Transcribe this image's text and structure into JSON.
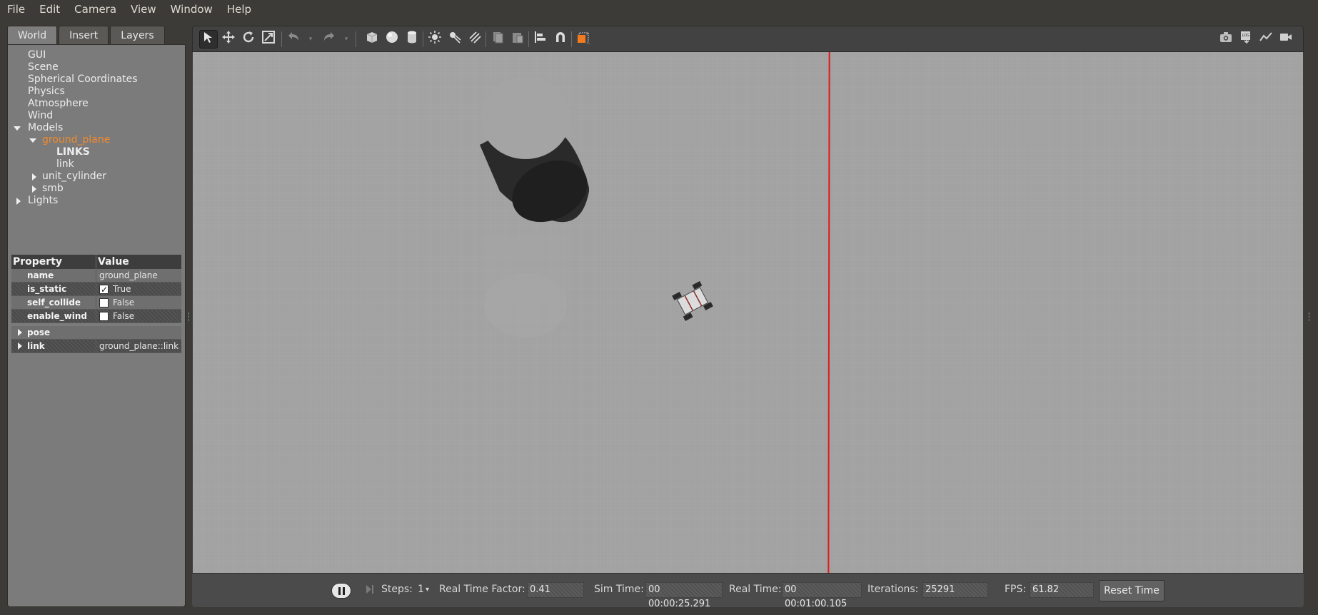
{
  "menu": [
    "File",
    "Edit",
    "Camera",
    "View",
    "Window",
    "Help"
  ],
  "left_tabs": [
    "World",
    "Insert",
    "Layers"
  ],
  "tree": {
    "gui": "GUI",
    "scene": "Scene",
    "spherical": "Spherical Coordinates",
    "physics": "Physics",
    "atmosphere": "Atmosphere",
    "wind": "Wind",
    "models": "Models",
    "ground_plane": "ground_plane",
    "links": "LINKS",
    "link": "link",
    "unit_cylinder": "unit_cylinder",
    "smb": "smb",
    "lights": "Lights"
  },
  "properties": {
    "header_property": "Property",
    "header_value": "Value",
    "rows": [
      {
        "key": "name",
        "value": "ground_plane"
      },
      {
        "key": "is_static",
        "value": "True",
        "checked": true
      },
      {
        "key": "self_collide",
        "value": "False",
        "checked": false
      },
      {
        "key": "enable_wind",
        "value": "False",
        "checked": false
      }
    ],
    "pose": "pose",
    "link_key": "link",
    "link_value": "ground_plane::link"
  },
  "status": {
    "steps_label": "Steps:",
    "steps_value": "1",
    "rtf_label": "Real Time Factor:",
    "rtf_value": "0.41",
    "sim_time_label": "Sim Time:",
    "sim_time_value": "00 00:00:25.291",
    "real_time_label": "Real Time:",
    "real_time_value": "00 00:01:00.105",
    "iterations_label": "Iterations:",
    "iterations_value": "25291",
    "fps_label": "FPS:",
    "fps_value": "61.82",
    "reset_label": "Reset Time"
  },
  "colors": {
    "selected": "#f08a2c",
    "axis_line": "#e0181b",
    "accent_orange": "#f37a1f"
  }
}
